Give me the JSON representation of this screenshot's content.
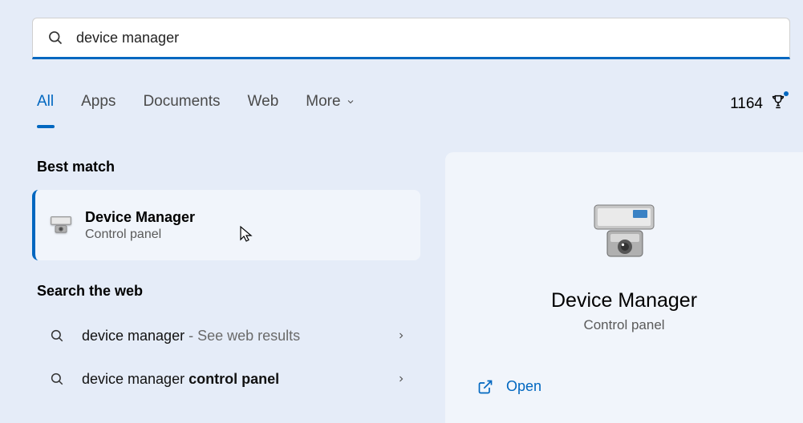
{
  "search": {
    "value": "device manager"
  },
  "tabs": {
    "all": "All",
    "apps": "Apps",
    "documents": "Documents",
    "web": "Web",
    "more": "More"
  },
  "rewards": {
    "count": "1164"
  },
  "sections": {
    "best_match": "Best match",
    "search_web": "Search the web"
  },
  "best": {
    "title": "Device Manager",
    "subtitle": "Control panel"
  },
  "web_results": [
    {
      "prefix": "device manager",
      "suffix": " - See web results"
    },
    {
      "prefix": "device manager ",
      "bold": "control panel"
    }
  ],
  "preview": {
    "title": "Device Manager",
    "subtitle": "Control panel",
    "open": "Open"
  }
}
